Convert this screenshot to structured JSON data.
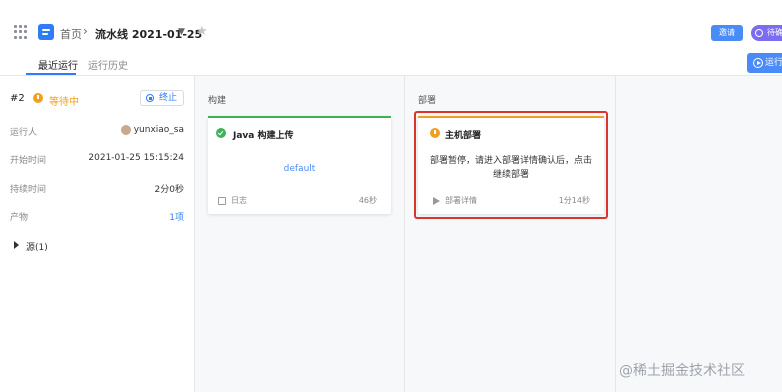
{
  "header": {
    "home": "首页",
    "separator": "›",
    "pipeline_title": "流水线 2021-01-25",
    "invite_label": "邀请",
    "status_label": "待确认"
  },
  "tabs": [
    {
      "label": "最近运行",
      "active": true
    },
    {
      "label": "运行历史",
      "active": false
    }
  ],
  "run_button_label": "运行",
  "run": {
    "id": "#2",
    "status": "等待中",
    "stop_label": "终止",
    "fields": [
      {
        "label": "运行人",
        "value": "yunxiao_sa"
      },
      {
        "label": "开始时间",
        "value": "2021-01-25 15:15:24"
      },
      {
        "label": "持续时间",
        "value": "2分0秒"
      },
      {
        "label": "产物",
        "value": "1项"
      }
    ],
    "source_label": "源(1)"
  },
  "stages": [
    {
      "title": "构建",
      "job": {
        "name": "Java 构建上传",
        "status": "success",
        "body": "default",
        "foot_left": "日志",
        "foot_right": "46秒",
        "bar_color": "#3cb35a"
      }
    },
    {
      "title": "部署",
      "job": {
        "name": "主机部署",
        "status": "waiting",
        "body": "部署暂停，请进入部署详情确认后，点击继续部署",
        "foot_left": "部署详情",
        "foot_right": "1分14秒",
        "bar_color": "#f0a020"
      }
    }
  ],
  "watermark": "@稀土掘金技术社区",
  "colors": {
    "accent": "#2f7cf6",
    "warning": "#f0a020",
    "success": "#3cb35a",
    "highlight": "#d9352e"
  }
}
